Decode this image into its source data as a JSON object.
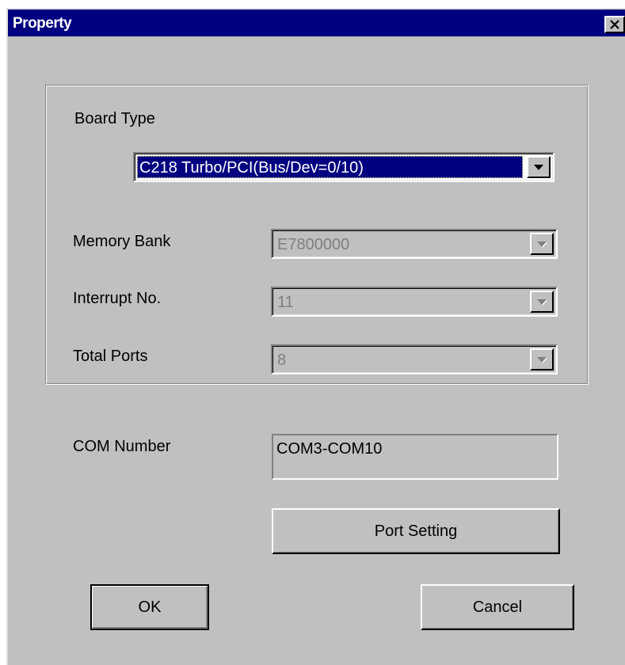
{
  "window": {
    "title": "Property"
  },
  "titlebar": {
    "close_glyph": "✕"
  },
  "board_type": {
    "label": "Board Type",
    "value": "C218 Turbo/PCI(Bus/Dev=0/10)"
  },
  "memory_bank": {
    "label": "Memory Bank",
    "value": "E7800000"
  },
  "interrupt": {
    "label": "Interrupt No.",
    "value": "11"
  },
  "total_ports": {
    "label": "Total Ports",
    "value": "8"
  },
  "com_number": {
    "label": "COM Number",
    "value": "COM3-COM10"
  },
  "buttons": {
    "port_setting": "Port Setting",
    "ok": "OK",
    "cancel": "Cancel"
  },
  "colors": {
    "titlebar": "#000080",
    "face": "#c0c0c0",
    "selection": "#000080"
  }
}
